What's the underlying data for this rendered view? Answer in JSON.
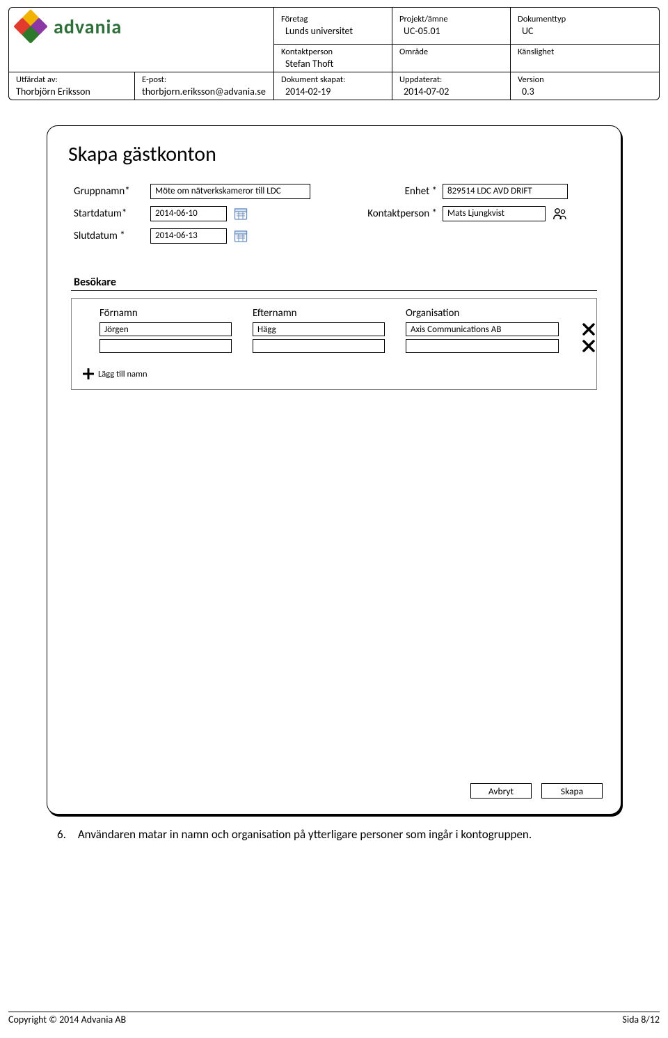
{
  "header": {
    "logo_text": "advania",
    "company_label": "Företag",
    "company_value": "Lunds universitet",
    "project_label": "Projekt/ämne",
    "project_value": "UC-05.01",
    "doctype_label": "Dokumenttyp",
    "doctype_value": "UC",
    "contact_label": "Kontaktperson",
    "contact_value": "Stefan Thoft",
    "area_label": "Område",
    "sensitivity_label": "Känslighet",
    "issued_by_label": "Utfärdat av:",
    "issued_by_value": "Thorbjörn Eriksson",
    "email_label": "E-post:",
    "email_value": "thorbjorn.eriksson@advania.se",
    "created_label": "Dokument skapat:",
    "created_value": "2014-02-19",
    "updated_label": "Uppdaterat:",
    "updated_value": "2014-07-02",
    "version_label": "Version",
    "version_value": "0.3"
  },
  "form": {
    "title": "Skapa gästkonton",
    "groupname_label": "Gruppnamn*",
    "groupname_value": "Möte om nätverkskameror till LDC",
    "unit_label": "Enhet *",
    "unit_value": "829514 LDC AVD DRIFT",
    "startdate_label": "Startdatum*",
    "startdate_value": "2014-06-10",
    "contactperson_label": "Kontaktperson *",
    "contactperson_value": "Mats Ljungkvist",
    "enddate_label": "Slutdatum *",
    "enddate_value": "2014-06-13",
    "visitors_title": "Besökare",
    "col_first": "Förnamn",
    "col_last": "Efternamn",
    "col_org": "Organisation",
    "rows": [
      {
        "first": "Jörgen",
        "last": "Hägg",
        "org": "Axis Communications AB"
      },
      {
        "first": "",
        "last": "",
        "org": ""
      }
    ],
    "add_label": "Lägg till namn",
    "cancel": "Avbryt",
    "create": "Skapa"
  },
  "step": {
    "number": "6.",
    "text": "Användaren matar in namn och organisation på ytterligare personer som ingår i kontogruppen."
  },
  "footer": {
    "copyright": "Copyright © 2014 Advania AB",
    "page": "Sida 8/12"
  }
}
